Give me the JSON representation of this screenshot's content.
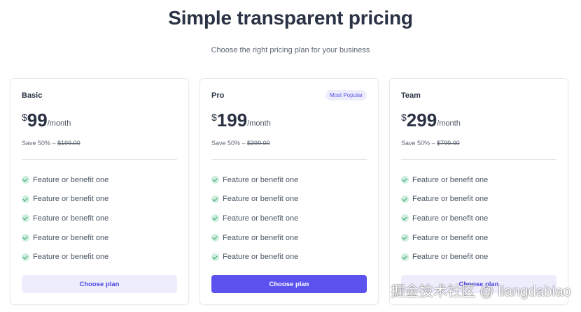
{
  "header": {
    "title": "Simple transparent pricing",
    "subtitle": "Choose the right pricing plan for your business"
  },
  "plans": [
    {
      "name": "Basic",
      "badge": "",
      "currency": "$",
      "price": "99",
      "period": "/month",
      "savings_prefix": "Save 50% – ",
      "original_price": "$199.00",
      "features": [
        "Feature or benefit one",
        "Feature or benefit one",
        "Feature or benefit one",
        "Feature or benefit one",
        "Feature or benefit one"
      ],
      "cta_label": "Choose plan"
    },
    {
      "name": "Pro",
      "badge": "Most Popular",
      "currency": "$",
      "price": "199",
      "period": "/month",
      "savings_prefix": "Save 50% – ",
      "original_price": "$399.00",
      "features": [
        "Feature or benefit one",
        "Feature or benefit one",
        "Feature or benefit one",
        "Feature or benefit one",
        "Feature or benefit one"
      ],
      "cta_label": "Choose plan"
    },
    {
      "name": "Team",
      "badge": "",
      "currency": "$",
      "price": "299",
      "period": "/month",
      "savings_prefix": "Save 50% – ",
      "original_price": "$799.00",
      "features": [
        "Feature or benefit one",
        "Feature or benefit one",
        "Feature or benefit one",
        "Feature or benefit one",
        "Feature or benefit one"
      ],
      "cta_label": "Choose plan"
    }
  ],
  "icons": {
    "feature": "check-circle-icon"
  },
  "colors": {
    "accent": "#5b52f0",
    "accent_light": "#eeedfc",
    "check": "#2f9e6b"
  },
  "watermark": "掘金技术社区 @ liangdabiao"
}
